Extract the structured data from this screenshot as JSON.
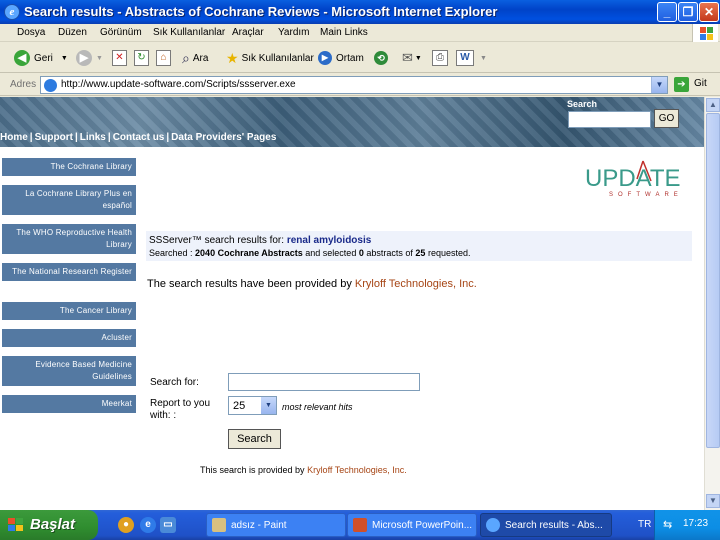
{
  "window": {
    "title": "Search results - Abstracts of Cochrane Reviews - Microsoft Internet Explorer",
    "minimize": "_",
    "maximize": "❐",
    "close": "✕"
  },
  "menu": {
    "items": [
      "Dosya",
      "Düzen",
      "Görünüm",
      "Sık Kullanılanlar",
      "Araçlar",
      "Yardım",
      "Main Links"
    ]
  },
  "toolbar": {
    "back_label": "Geri",
    "search_label": "Ara",
    "favorites_label": "Sık Kullanılanlar",
    "media_label": "Ortam"
  },
  "address": {
    "label": "Adres",
    "url": "http://www.update-software.com/Scripts/ssserver.exe",
    "go_label": "Git"
  },
  "banner": {
    "search_label": "Search",
    "go_label": "GO",
    "nav": [
      "Home",
      "Support",
      "Links",
      "Contact us",
      "Data Providers' Pages"
    ]
  },
  "sidebar": {
    "items": [
      "The Cochrane Library",
      "La Cochrane Library Plus en español",
      "The WHO Reproductive Health Library",
      "The National Research Register",
      "The Cancer Library",
      "Acluster",
      "Evidence Based Medicine Guidelines",
      "Meerkat"
    ]
  },
  "logo": {
    "word": "UPDATE",
    "tagline": "SOFTWARE"
  },
  "results": {
    "line1_prefix": "SSServer™ search results for:",
    "query": "renal amyloidosis",
    "line2_prefix": "Searched :",
    "searched": "2040 Cochrane Abstracts",
    "line2_mid": "and selected",
    "selected": "0",
    "line2_mid2": "abstracts of",
    "requested": "25",
    "line2_suffix": "requested."
  },
  "provided": {
    "text": "The search results have been provided by",
    "link": "Kryloff Technologies, Inc."
  },
  "form": {
    "search_for_label": "Search for:",
    "search_for_value": "",
    "report_label_1": "Report to you",
    "report_label_2": "with: :",
    "report_value": "25",
    "most_relevant": "most relevant hits",
    "search_button": "Search"
  },
  "footer": {
    "text": "This search is provided by",
    "link": "Kryloff Technologies, Inc."
  },
  "taskbar": {
    "start_label": "Başlat",
    "tasks": [
      "adsız - Paint",
      "Microsoft PowerPoin...",
      "Search results - Abs..."
    ],
    "language": "TR",
    "clock": "17:23"
  }
}
